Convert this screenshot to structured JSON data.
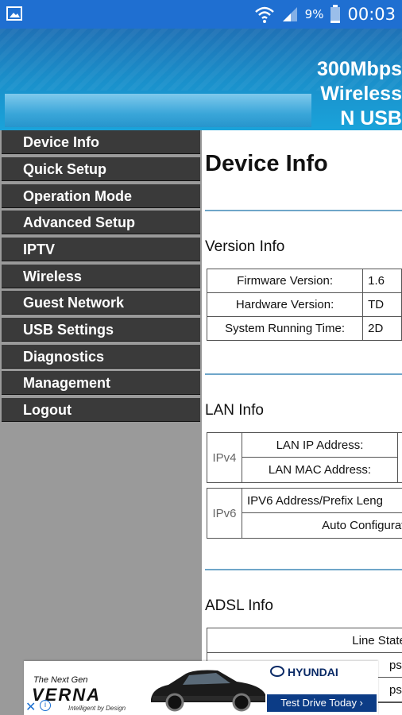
{
  "status_bar": {
    "battery_percent": "9%",
    "time": "00:03",
    "icons": [
      "image-icon",
      "wifi-icon",
      "signal-icon",
      "battery-icon"
    ]
  },
  "header": {
    "product_lines": [
      "300Mbps",
      "Wireless",
      "N USB"
    ]
  },
  "sidebar": {
    "items": [
      {
        "label": "Device Info"
      },
      {
        "label": "Quick Setup"
      },
      {
        "label": "Operation Mode"
      },
      {
        "label": "Advanced Setup"
      },
      {
        "label": "IPTV"
      },
      {
        "label": "Wireless"
      },
      {
        "label": "Guest Network"
      },
      {
        "label": "USB Settings"
      },
      {
        "label": "Diagnostics"
      },
      {
        "label": "Management"
      },
      {
        "label": "Logout"
      }
    ]
  },
  "main": {
    "title": "Device Info",
    "version_info": {
      "title": "Version Info",
      "rows": [
        {
          "label": "Firmware Version:",
          "value": "1.6"
        },
        {
          "label": "Hardware Version:",
          "value": "TD"
        },
        {
          "label": "System Running Time:",
          "value": "2D"
        }
      ]
    },
    "lan_info": {
      "title": "LAN Info",
      "ipv4": {
        "tag": "IPv4",
        "rows": [
          "LAN IP Address:",
          "LAN MAC Address:"
        ]
      },
      "ipv6": {
        "tag": "IPv6",
        "rows": [
          "IPV6 Address/Prefix Leng",
          "Auto Configuratio"
        ]
      }
    },
    "adsl_info": {
      "title": "ADSL Info",
      "rows": [
        "Line State:",
        "ps):",
        "ps):"
      ]
    }
  },
  "ad": {
    "tagline": "The Next Gen",
    "model": "VERNA",
    "slogan": "Intelligent by Design",
    "brand": "HYUNDAI",
    "cta": "Test Drive Today ›"
  },
  "colors": {
    "status_bar": "#1f6fd1",
    "header": "#1a8fca",
    "sidebar_item": "#3a3a3a",
    "sidebar_bg": "#9a9a9a",
    "divider": "#6fa6c9"
  }
}
